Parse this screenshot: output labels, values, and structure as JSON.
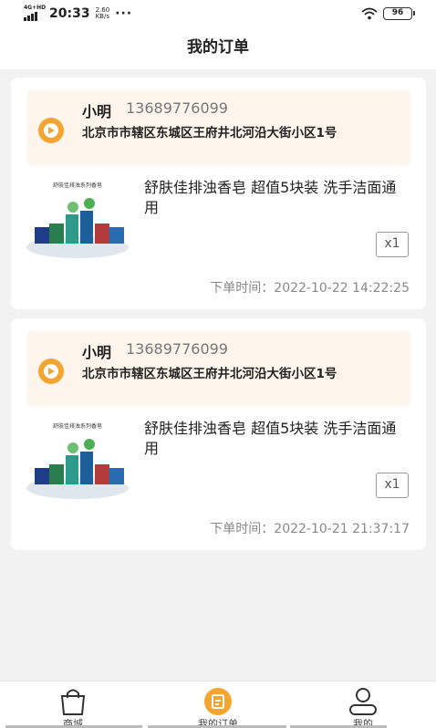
{
  "status_bar": {
    "network": "4G+HD",
    "time": "20:33",
    "speed_value": "2.60",
    "speed_unit": "KB/s",
    "more": "···",
    "battery": "96"
  },
  "header": {
    "title": "我的订单"
  },
  "colors": {
    "accent": "#f3a52f",
    "address_bg": "#fdf5ec",
    "page_bg": "#f2f2f2"
  },
  "orders": [
    {
      "name": "小明",
      "phone": "13689776099",
      "address": "北京市市辖区东城区王府井北河沿大街小区1号",
      "product_title": "舒肤佳排浊香皂 超值5块装 洗手洁面通用",
      "product_image_caption": "舒肤佳排浊系列香皂",
      "quantity": "x1",
      "order_time": "下单时间：2022-10-22 14:22:25"
    },
    {
      "name": "小明",
      "phone": "13689776099",
      "address": "北京市市辖区东城区王府井北河沿大街小区1号",
      "product_title": "舒肤佳排浊香皂 超值5块装 洗手洁面通用",
      "product_image_caption": "舒肤佳排浊系列香皂",
      "quantity": "x1",
      "order_time": "下单时间：2022-10-21 21:37:17"
    }
  ],
  "tabs": [
    {
      "label": "商城",
      "icon": "shopping-bag-icon"
    },
    {
      "label": "我的订单",
      "icon": "orders-icon",
      "active": true
    },
    {
      "label": "我的",
      "icon": "user-icon"
    }
  ]
}
